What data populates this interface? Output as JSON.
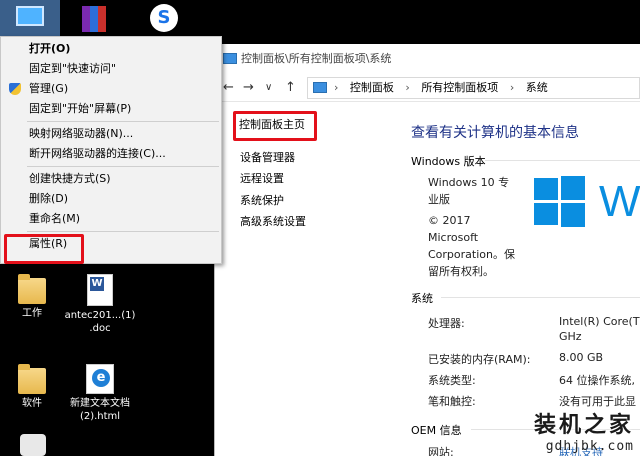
{
  "desktop": {
    "icons": [
      {
        "label": "工作"
      },
      {
        "label": "antec201...(1) .doc"
      },
      {
        "label": "软件"
      },
      {
        "label": "新建文本文档 (2).html"
      }
    ]
  },
  "context_menu": {
    "items": [
      {
        "label": "打开(O)"
      },
      {
        "label": "固定到\"快速访问\""
      },
      {
        "label": "管理(G)"
      },
      {
        "label": "固定到\"开始\"屏幕(P)"
      },
      {
        "label": "映射网络驱动器(N)..."
      },
      {
        "label": "断开网络驱动器的连接(C)..."
      },
      {
        "label": "创建快捷方式(S)"
      },
      {
        "label": "删除(D)"
      },
      {
        "label": "重命名(M)"
      },
      {
        "label": "属性(R)"
      }
    ]
  },
  "window": {
    "title": "控制面板\\所有控制面板项\\系统",
    "nav": {
      "back": "←",
      "forward": "→",
      "dropdown": "∨",
      "up": "↑"
    },
    "address": {
      "crumbs": [
        "控制面板",
        "所有控制面板项",
        "系统"
      ]
    },
    "left": {
      "home": "控制面板主页",
      "links": [
        "设备管理器",
        "远程设置",
        "系统保护",
        "高级系统设置"
      ]
    },
    "heading": "查看有关计算机的基本信息",
    "edition_section": "Windows 版本",
    "edition_name": "Windows 10 专业版",
    "copyright": "© 2017 Microsoft Corporation。保留所有权利。",
    "logo_text": "W",
    "system_section": "系统",
    "rows": [
      {
        "label": "处理器:",
        "value": "Intel(R) Core(TM"
      },
      {
        "label": "",
        "value": "GHz"
      },
      {
        "label": "已安装的内存(RAM):",
        "value": "8.00 GB"
      },
      {
        "label": "系统类型:",
        "value": "64 位操作系统,"
      },
      {
        "label": "笔和触控:",
        "value": "没有可用于此显"
      }
    ],
    "oem_section": "OEM 信息",
    "website_label": "网站:",
    "website_value": "联机支持"
  },
  "watermark": {
    "cn": "装机之家",
    "en": "gdhjbk.com"
  },
  "colors": {
    "highlight_box": "#e3101a",
    "heading": "#1e3287",
    "windows_blue": "#0a8ee0"
  }
}
